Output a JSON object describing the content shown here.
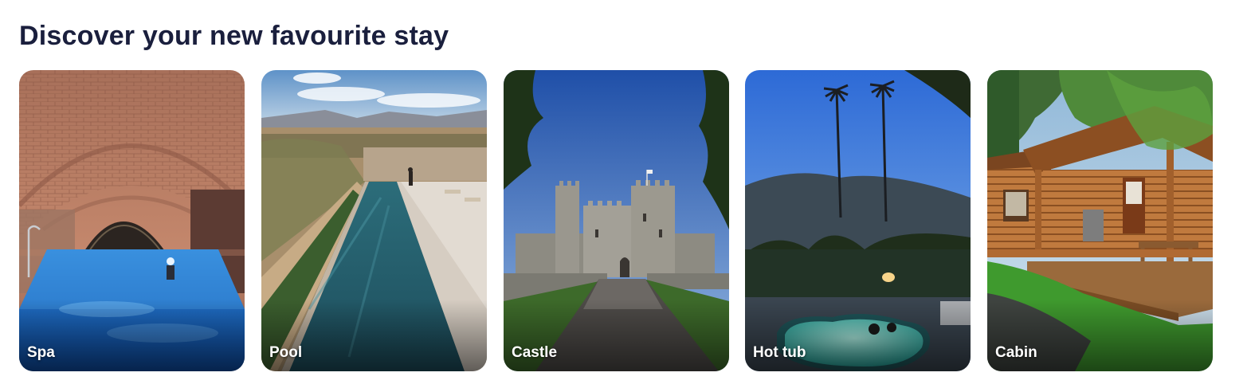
{
  "section": {
    "title": "Discover your new favourite stay"
  },
  "cards": [
    {
      "label": "Spa",
      "image": "indoor-pool-brick-vault-photo"
    },
    {
      "label": "Pool",
      "image": "infinity-pool-desert-photo"
    },
    {
      "label": "Castle",
      "image": "stone-castle-photo"
    },
    {
      "label": "Hot tub",
      "image": "hot-tub-palm-trees-photo"
    },
    {
      "label": "Cabin",
      "image": "log-cabin-photo"
    }
  ]
}
